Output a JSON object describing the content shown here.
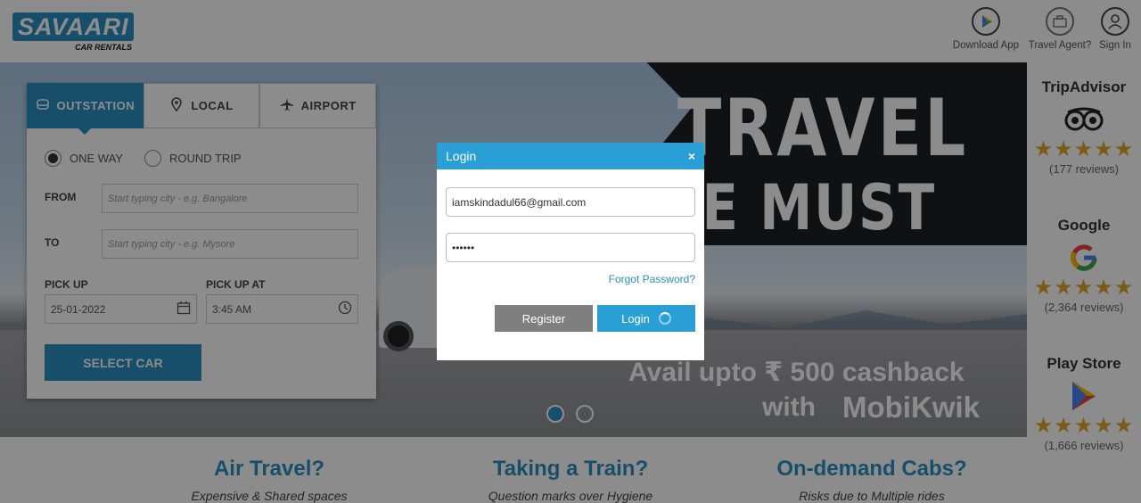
{
  "header": {
    "logo_text": "SAVAARI",
    "logo_sub": "CAR RENTALS",
    "items": [
      {
        "label": "Download App",
        "icon": "play-store-icon"
      },
      {
        "label": "Travel Agent?",
        "icon": "briefcase-icon"
      },
      {
        "label": "Sign In",
        "icon": "user-icon"
      }
    ]
  },
  "hero": {
    "headline_1": "TRAVEL",
    "headline_2": "WE MUST",
    "offer_line": "Avail upto ₹ 500 cashback",
    "offer_with": "with",
    "offer_brand": "MobiKwik",
    "carousel_active": 0
  },
  "booking": {
    "tabs": [
      {
        "label": "OUTSTATION",
        "icon": "car-front-icon",
        "active": true
      },
      {
        "label": "LOCAL",
        "icon": "location-pin-icon",
        "active": false
      },
      {
        "label": "AIRPORT",
        "icon": "airplane-icon",
        "active": false
      }
    ],
    "trip_types": [
      {
        "label": "ONE WAY",
        "checked": true
      },
      {
        "label": "ROUND TRIP",
        "checked": false
      }
    ],
    "from_label": "FROM",
    "from_placeholder": "Start typing city - e.g. Bangalore",
    "to_label": "TO",
    "to_placeholder": "Start typing city - e.g. Mysore",
    "pickup_label": "PICK UP",
    "pickup_date": "25-01-2022",
    "pickup_at_label": "PICK UP AT",
    "pickup_time": "3:45 AM",
    "submit_label": "SELECT CAR"
  },
  "ratings": [
    {
      "name": "TripAdvisor",
      "stars": "★★★★★",
      "count": "(177 reviews)",
      "icon": "tripadvisor-owl-icon"
    },
    {
      "name": "Google",
      "stars": "★★★★★",
      "count": "(2,364 reviews)",
      "icon": "google-g-icon"
    },
    {
      "name": "Play Store",
      "stars": "★★★★★",
      "count": "(1,666 reviews)",
      "icon": "play-store-icon"
    }
  ],
  "features": [
    {
      "title": "Air Travel?",
      "subtitle": "Expensive & Shared spaces"
    },
    {
      "title": "Taking a Train?",
      "subtitle": "Question marks over Hygiene"
    },
    {
      "title": "On-demand Cabs?",
      "subtitle": "Risks due to Multiple rides"
    }
  ],
  "login_modal": {
    "title": "Login",
    "close": "×",
    "email_value": "iamskindadul66@gmail.com",
    "password_value": "••••••",
    "forgot_label": "Forgot Password?",
    "register_label": "Register",
    "login_label": "Login"
  },
  "colors": {
    "brand": "#2a8fc1",
    "modal_header": "#2a9fd6",
    "register_button": "#7f7f7f",
    "star": "#e0a82a"
  }
}
